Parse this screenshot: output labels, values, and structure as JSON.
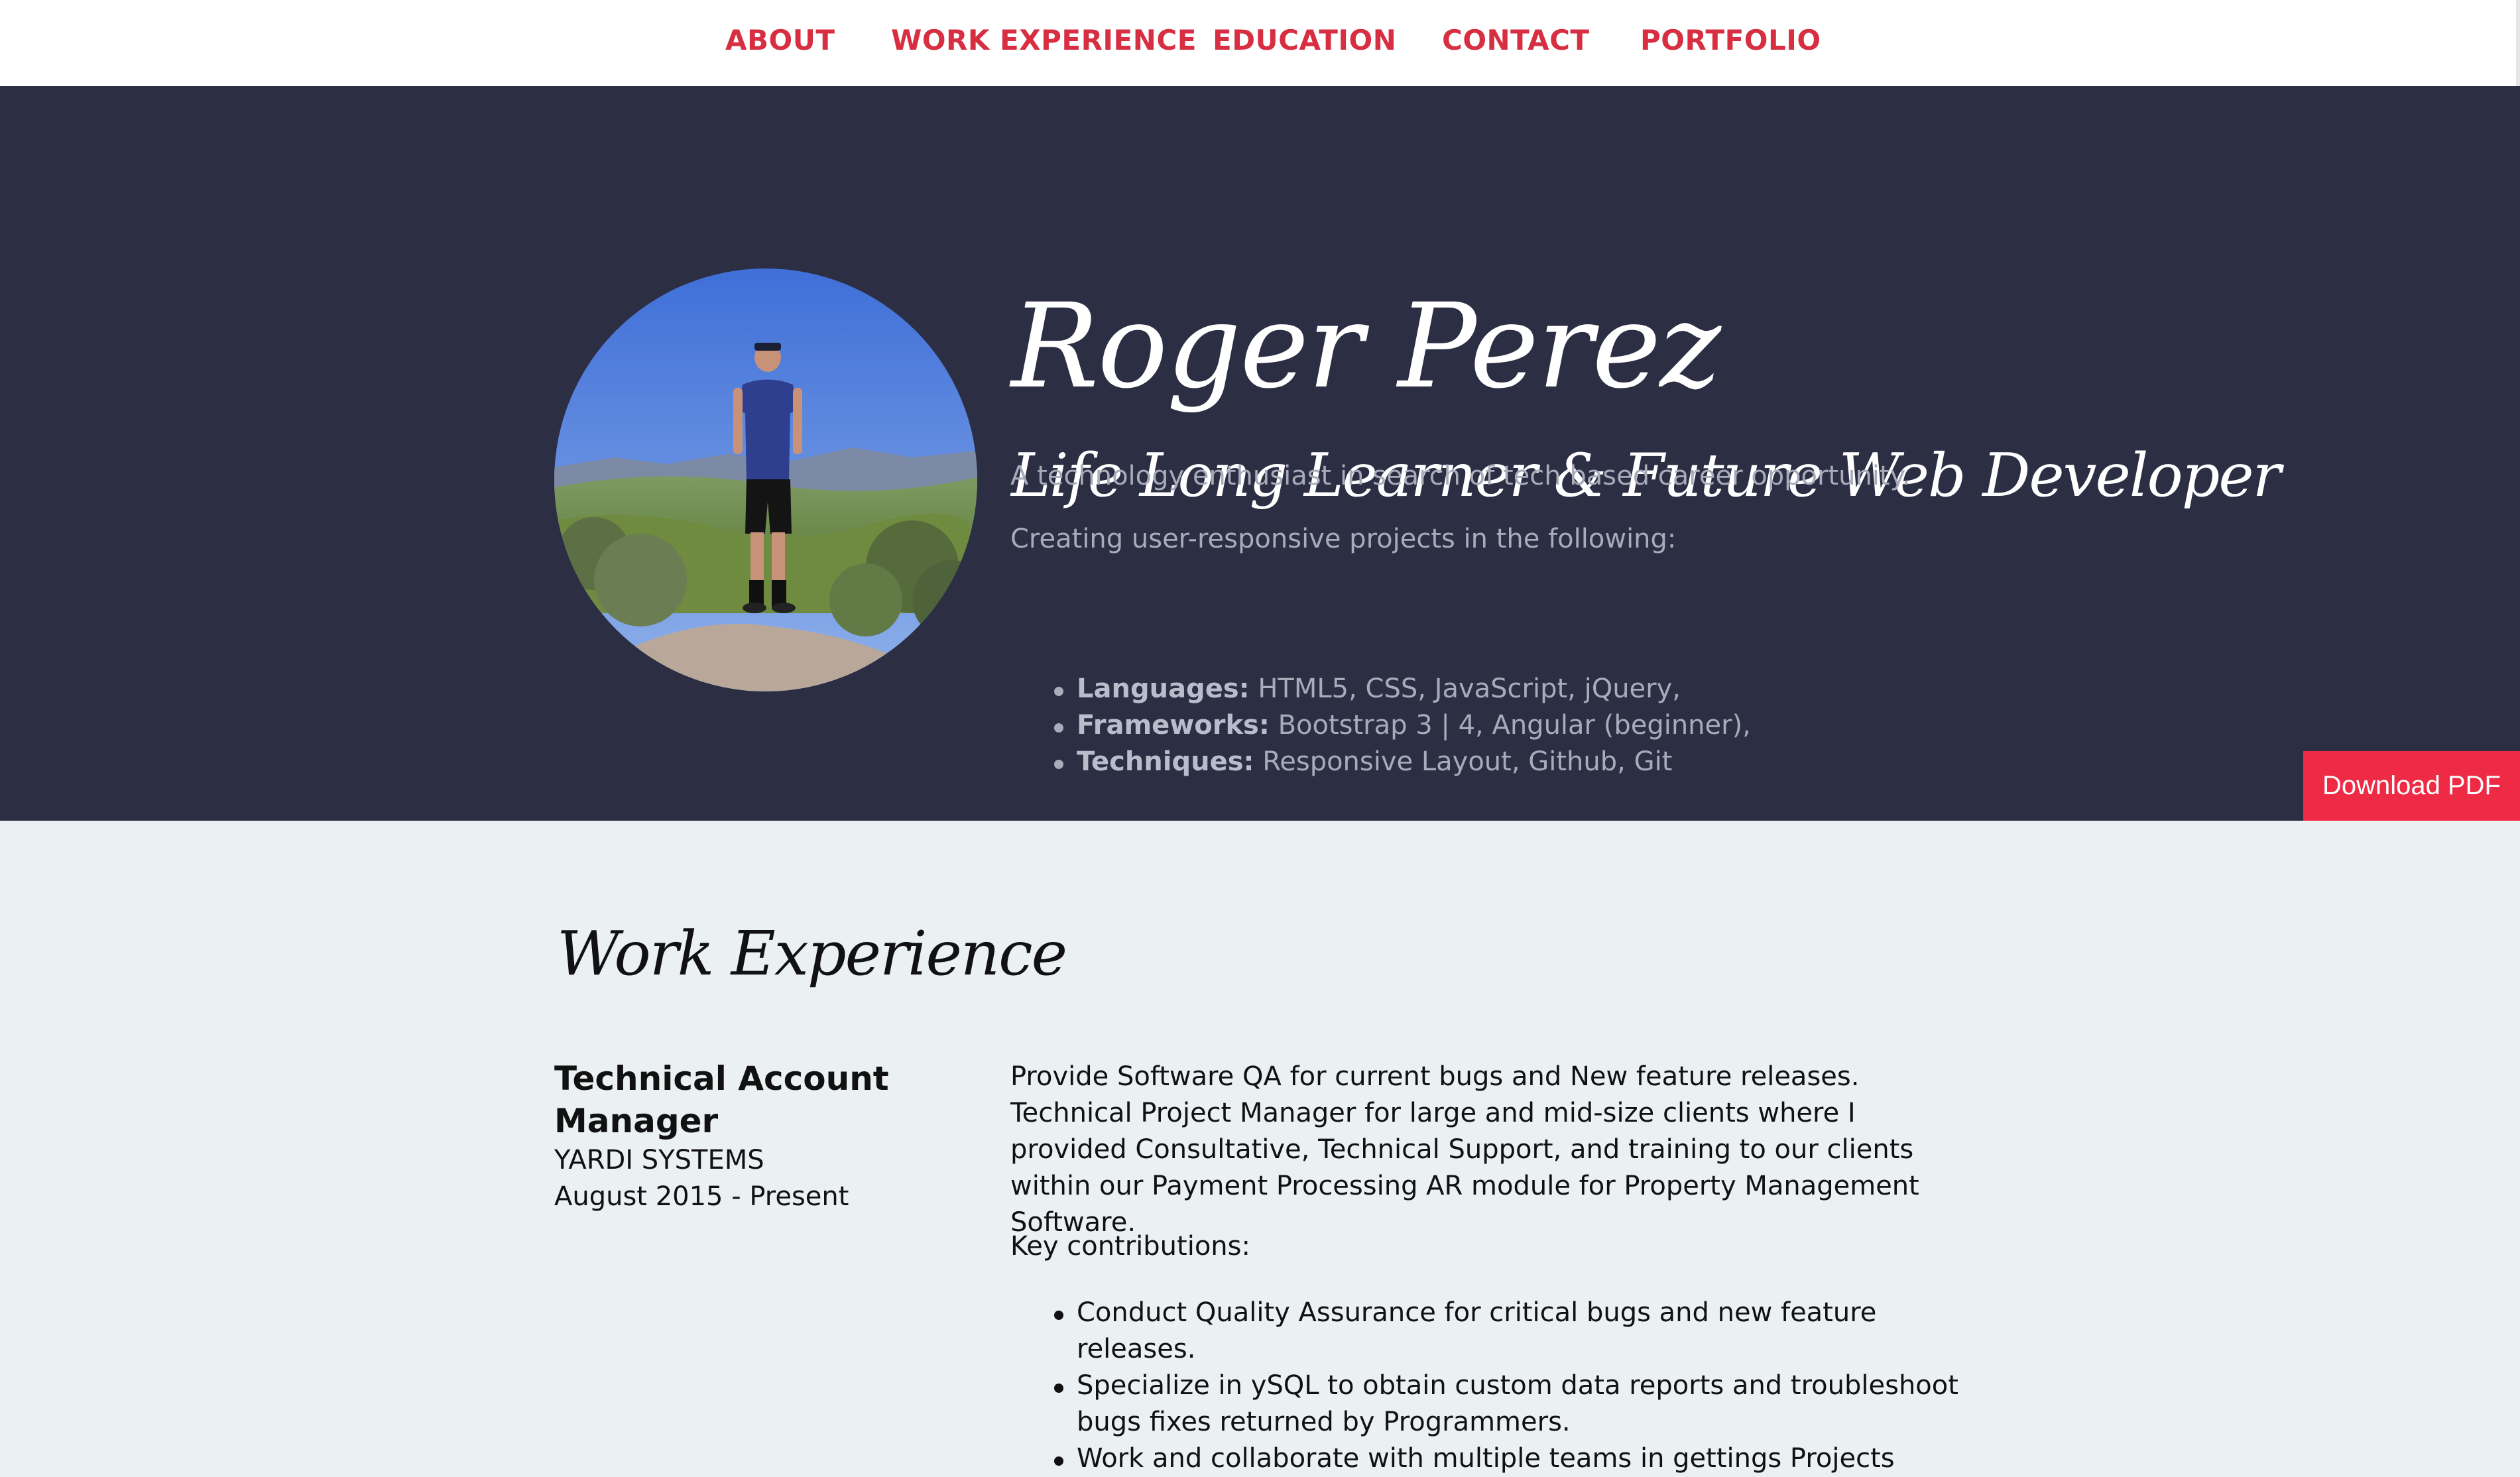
{
  "nav": {
    "items": [
      {
        "label": "ABOUT"
      },
      {
        "label": "WORK EXPERIENCE"
      },
      {
        "label": "EDUCATION"
      },
      {
        "label": "CONTACT"
      },
      {
        "label": "PORTFOLIO"
      }
    ]
  },
  "hero": {
    "name": "Roger Perez",
    "tagline": "Life Long Learner & Future Web Developer",
    "intro": "A technology enthusiast in search of tech based career opportunity.",
    "creating": "Creating user-responsive projects in the following:",
    "skills": [
      {
        "label": "Languages:",
        "value": " HTML5, CSS, JavaScript, jQuery,"
      },
      {
        "label": "Frameworks:",
        "value": " Bootstrap 3 | 4, Angular (beginner),"
      },
      {
        "label": "Techniques:",
        "value": " Responsive Layout, Github, Git"
      }
    ],
    "download_label": "Download PDF"
  },
  "work": {
    "section_title": "Work Experience",
    "job": {
      "title": "Technical Account Manager",
      "company": "YARDI SYSTEMS",
      "dates": "August 2015 - Present",
      "description": "Provide Software QA for current bugs and New feature releases. Technical Project Manager for large and mid-size clients where I provided Consultative, Technical Support, and training to our clients within our Payment Processing AR module for Property Management Software.",
      "key_label": "Key contributions:",
      "contributions": [
        "Conduct Quality Assurance for critical bugs and new feature releases.",
        "Specialize in ySQL to obtain custom data reports and troubleshoot bugs fixes returned by Programmers.",
        "Work and collaborate with multiple teams in gettings Projects"
      ]
    }
  },
  "colors": {
    "accent": "#d72e42",
    "hero_bg": "#2c2e43",
    "button_bg": "#ee2a45",
    "page_bg": "#ebf0f2"
  }
}
